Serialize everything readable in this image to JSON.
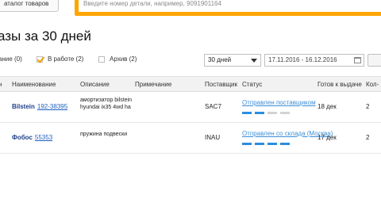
{
  "header": {
    "catalog_button": "аталог товаров",
    "search_placeholder": "Введите номер детали, например, 9091901164"
  },
  "page_title": "азы за 30 дней",
  "filters": {
    "items": [
      {
        "label": "ание (0)",
        "checked": false,
        "has_checkbox": false
      },
      {
        "label": "В работе (2)",
        "checked": true,
        "has_checkbox": true
      },
      {
        "label": "Архив (2)",
        "checked": false,
        "has_checkbox": true
      }
    ],
    "period": "30 дней",
    "date_range": "17.11.2016 - 16.12.2016"
  },
  "table": {
    "headers": [
      "н",
      "Наименование",
      "Описание",
      "Примечание",
      "Поставщик",
      "Статус",
      "Готов к выдаче",
      "Кол-"
    ],
    "rows": [
      {
        "brand": "Bilstein",
        "article": "192-38395",
        "description": "амортизатор bilstein hyundai ix35 4wd ha",
        "note": "",
        "supplier": "SAC7",
        "status": "Отправлен поставщиком",
        "progress_steps_done": 2,
        "progress_steps_total": 4,
        "ready": "18 дек",
        "qty": "2"
      },
      {
        "brand": "Фобос",
        "article": "55353",
        "description": "пружина подвески",
        "note": "",
        "supplier": "INAU",
        "status": "Отправлен со склада (Москва)",
        "progress_steps_done": 4,
        "progress_steps_total": 4,
        "ready": "17 дек",
        "qty": "2"
      }
    ]
  }
}
